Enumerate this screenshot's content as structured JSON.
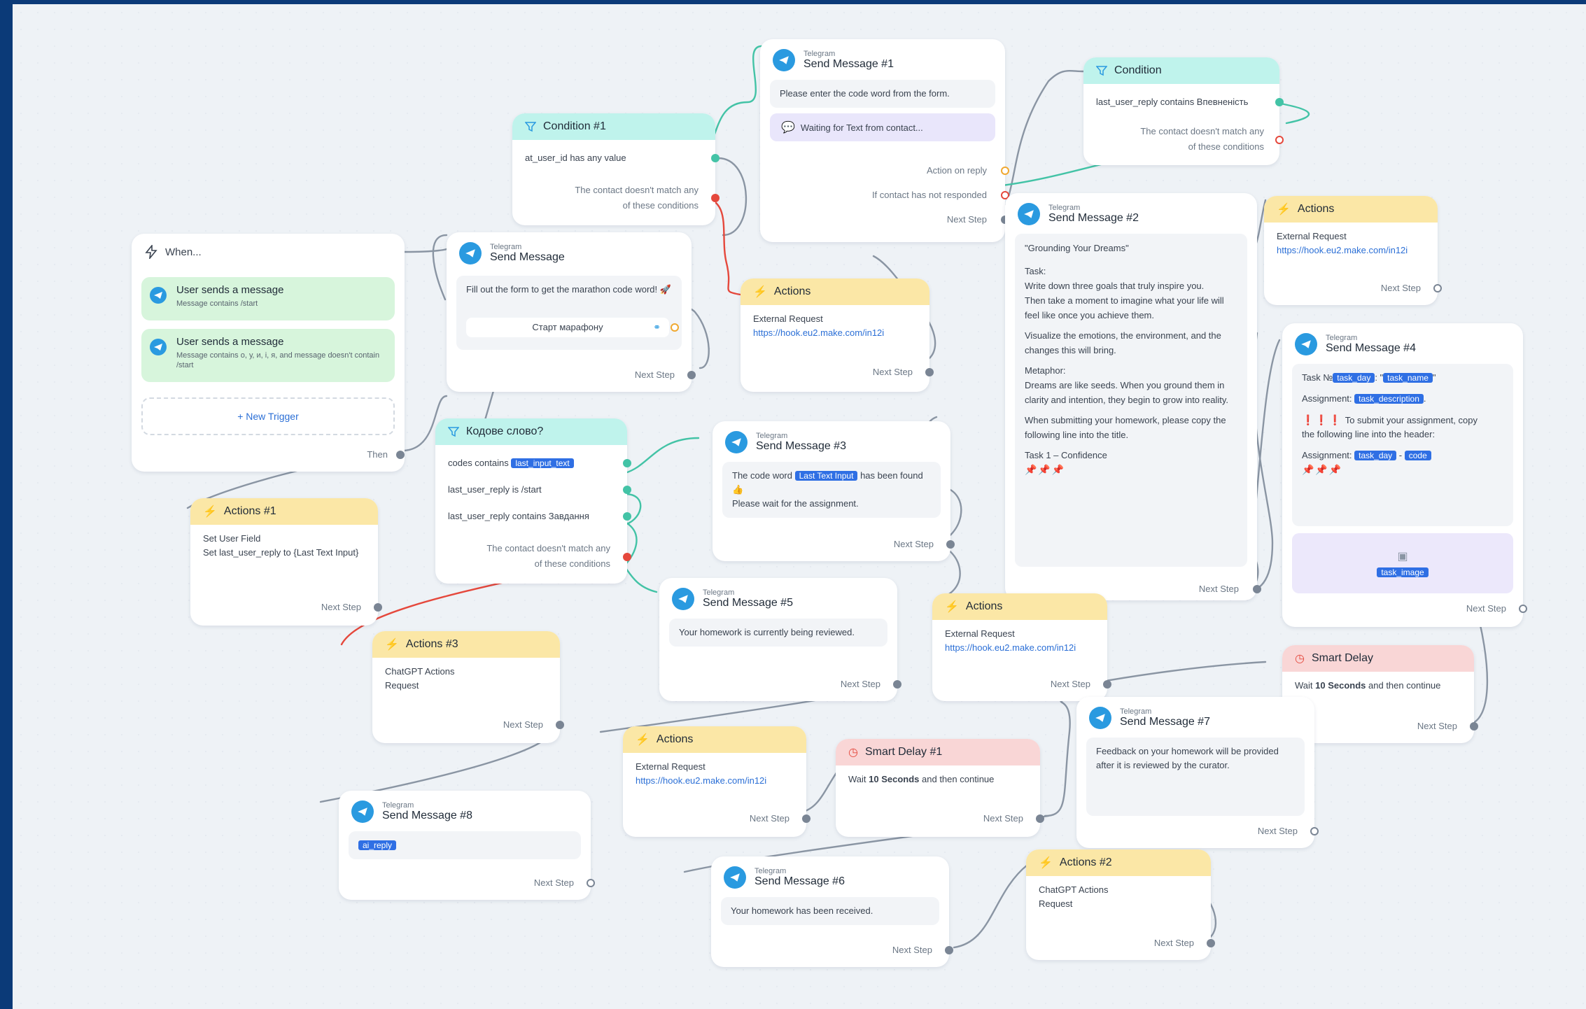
{
  "common": {
    "next_step": "Next Step"
  },
  "trigger": {
    "title": "When...",
    "items": [
      {
        "title": "User sends a message",
        "sub": "Message contains /start"
      },
      {
        "title": "User sends a message",
        "sub": "Message contains о, у, и, і, я, and message doesn't contain /start"
      }
    ],
    "new_trigger": "+ New Trigger",
    "then": "Then"
  },
  "cond1": {
    "title": "Condition #1",
    "rule": "at_user_id has any value",
    "else1": "The contact doesn't match any",
    "else2": "of these conditions"
  },
  "send": {
    "kind": "Telegram",
    "title": "Send Message",
    "text": "Fill out the form to get the marathon code word! 🚀",
    "button": "Старт марафону"
  },
  "msg1": {
    "kind": "Telegram",
    "title": "Send Message #1",
    "text": "Please enter the code word from the form.",
    "waiting": "Waiting for Text from contact...",
    "action_on_reply": "Action on reply",
    "not_responded": "If contact has not responded"
  },
  "cond2": {
    "title": "Condition",
    "rule": "last_user_reply contains Впевненість",
    "else1": "The contact doesn't match any",
    "else2": "of these conditions"
  },
  "actionsA": {
    "title": "Actions",
    "type": "External Request",
    "url": "https://hook.eu2.make.com/in12i"
  },
  "msg2": {
    "kind": "Telegram",
    "title": "Send Message #2",
    "l1": "\"Grounding Your Dreams\"",
    "l2": "Task:",
    "l3": "Write down three goals that truly inspire you.",
    "l4": "Then take a moment to imagine what your life will feel like once you achieve them.",
    "l5": "Visualize the emotions, the environment, and the changes this will bring.",
    "l6": "Metaphor:",
    "l7": "Dreams are like seeds. When you ground them in clarity and intention, they begin to grow into reality.",
    "l8": "When submitting your homework, please copy the following line into the title.",
    "l9": "Task 1 – Confidence",
    "stars": "📌📌📌"
  },
  "actionsB": {
    "title": "Actions",
    "type": "External Request",
    "url": "https://hook.eu2.make.com/in12i"
  },
  "msg4": {
    "kind": "Telegram",
    "title": "Send Message #4",
    "task_prefix": "Task №",
    "tag_day": "task_day",
    "sep1": ": \"",
    "tag_name": "task_name",
    "quote": "\"",
    "assign_label": "Assignment: ",
    "tag_desc": "task_description",
    "dot": ".",
    "excl": "❗❗❗",
    "submit": "To submit your assignment, copy",
    "submit2": "the following line into the header:",
    "assign_label2": "Assignment: ",
    "dash": " - ",
    "tag_code": "code",
    "stars": "📌📌📌",
    "tag_image": "task_image"
  },
  "code": {
    "title": "Кодове слово?",
    "r1": "codes contains ",
    "r1_tag": "last_input_text",
    "r2": "last_user_reply is /start",
    "r3": "last_user_reply contains Завдання",
    "else1": "The contact doesn't match any",
    "else2": "of these conditions"
  },
  "actions1": {
    "title": "Actions #1",
    "type": "Set User Field",
    "detail": "Set last_user_reply to {Last Text Input}"
  },
  "msg3": {
    "kind": "Telegram",
    "title": "Send Message #3",
    "t1": "The code word ",
    "tag": "Last Text Input",
    "t2": " has been found 👍",
    "t3": "Please wait for the assignment."
  },
  "msg5": {
    "kind": "Telegram",
    "title": "Send Message #5",
    "text": "Your homework is currently being reviewed."
  },
  "actionsC": {
    "title": "Actions",
    "type": "External Request",
    "url": "https://hook.eu2.make.com/in12i"
  },
  "delay": {
    "title": "Smart Delay",
    "w1": "Wait ",
    "w2": "10 Seconds",
    "w3": " and then continue"
  },
  "actions3": {
    "title": "Actions #3",
    "type": "ChatGPT Actions",
    "detail": "Request"
  },
  "actionsD": {
    "title": "Actions",
    "type": "External Request",
    "url": "https://hook.eu2.make.com/in12i"
  },
  "delay1": {
    "title": "Smart Delay #1",
    "w1": "Wait ",
    "w2": "10 Seconds",
    "w3": " and then continue"
  },
  "msg7": {
    "kind": "Telegram",
    "title": "Send Message #7",
    "text": "Feedback on your homework will be provided after it is reviewed by the curator."
  },
  "msg8": {
    "kind": "Telegram",
    "title": "Send Message #8",
    "tag": "ai_reply"
  },
  "msg6": {
    "kind": "Telegram",
    "title": "Send Message #6",
    "text": "Your homework has been received."
  },
  "actions2": {
    "title": "Actions #2",
    "type": "ChatGPT Actions",
    "detail": "Request"
  }
}
